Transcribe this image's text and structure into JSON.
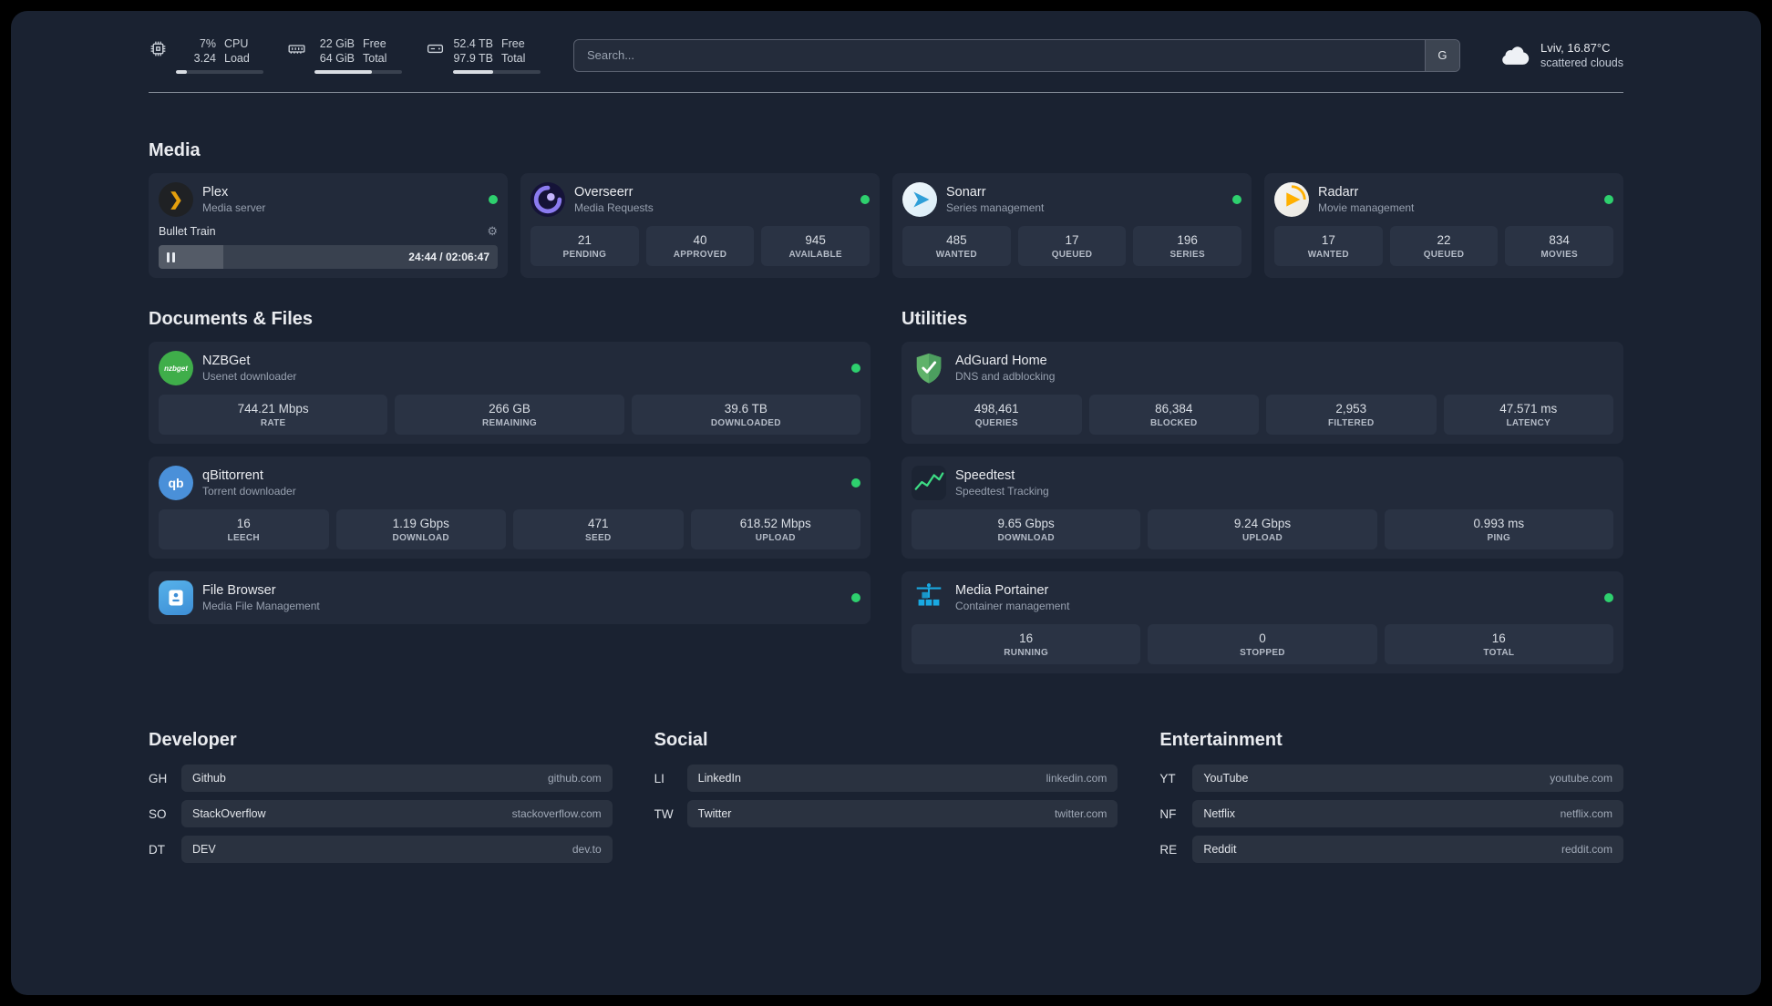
{
  "topbar": {
    "metrics": [
      {
        "val1": "7%",
        "val2": "3.24",
        "lab1": "CPU",
        "lab2": "Load"
      },
      {
        "val1": "22 GiB",
        "val2": "64 GiB",
        "lab1": "Free",
        "lab2": "Total"
      },
      {
        "val1": "52.4 TB",
        "val2": "97.9 TB",
        "lab1": "Free",
        "lab2": "Total"
      }
    ],
    "search": {
      "placeholder": "Search...",
      "button_label": "G"
    },
    "weather": {
      "location": "Lviv, 16.87°C",
      "condition": "scattered clouds"
    }
  },
  "sections": {
    "media": "Media",
    "documents": "Documents & Files",
    "utilities": "Utilities",
    "developer": "Developer",
    "social": "Social",
    "entertainment": "Entertainment"
  },
  "services": {
    "plex": {
      "name": "Plex",
      "desc": "Media server",
      "icon_glyph": "❯",
      "gear_glyph": "⚙",
      "now_playing": "Bullet Train",
      "time": "24:44 / 02:06:47"
    },
    "overseerr": {
      "name": "Overseerr",
      "desc": "Media Requests",
      "stats": [
        {
          "v": "21",
          "l": "PENDING"
        },
        {
          "v": "40",
          "l": "APPROVED"
        },
        {
          "v": "945",
          "l": "AVAILABLE"
        }
      ]
    },
    "sonarr": {
      "name": "Sonarr",
      "desc": "Series management",
      "stats": [
        {
          "v": "485",
          "l": "WANTED"
        },
        {
          "v": "17",
          "l": "QUEUED"
        },
        {
          "v": "196",
          "l": "SERIES"
        }
      ]
    },
    "radarr": {
      "name": "Radarr",
      "desc": "Movie management",
      "stats": [
        {
          "v": "17",
          "l": "WANTED"
        },
        {
          "v": "22",
          "l": "QUEUED"
        },
        {
          "v": "834",
          "l": "MOVIES"
        }
      ]
    },
    "nzbget": {
      "name": "NZBGet",
      "desc": "Usenet downloader",
      "icon_text": "nzbget",
      "stats": [
        {
          "v": "744.21 Mbps",
          "l": "RATE"
        },
        {
          "v": "266 GB",
          "l": "REMAINING"
        },
        {
          "v": "39.6 TB",
          "l": "DOWNLOADED"
        }
      ]
    },
    "qbittorrent": {
      "name": "qBittorrent",
      "desc": "Torrent downloader",
      "icon_text": "qb",
      "stats": [
        {
          "v": "16",
          "l": "LEECH"
        },
        {
          "v": "1.19 Gbps",
          "l": "DOWNLOAD"
        },
        {
          "v": "471",
          "l": "SEED"
        },
        {
          "v": "618.52 Mbps",
          "l": "UPLOAD"
        }
      ]
    },
    "filebrowser": {
      "name": "File Browser",
      "desc": "Media File Management"
    },
    "adguard": {
      "name": "AdGuard Home",
      "desc": "DNS and adblocking",
      "stats": [
        {
          "v": "498,461",
          "l": "QUERIES"
        },
        {
          "v": "86,384",
          "l": "BLOCKED"
        },
        {
          "v": "2,953",
          "l": "FILTERED"
        },
        {
          "v": "47.571 ms",
          "l": "LATENCY"
        }
      ]
    },
    "speedtest": {
      "name": "Speedtest",
      "desc": "Speedtest Tracking",
      "stats": [
        {
          "v": "9.65 Gbps",
          "l": "DOWNLOAD"
        },
        {
          "v": "9.24 Gbps",
          "l": "UPLOAD"
        },
        {
          "v": "0.993 ms",
          "l": "PING"
        }
      ]
    },
    "portainer": {
      "name": "Media Portainer",
      "desc": "Container management",
      "stats": [
        {
          "v": "16",
          "l": "RUNNING"
        },
        {
          "v": "0",
          "l": "STOPPED"
        },
        {
          "v": "16",
          "l": "TOTAL"
        }
      ]
    }
  },
  "bookmarks": {
    "developer": [
      {
        "abbr": "GH",
        "name": "Github",
        "domain": "github.com"
      },
      {
        "abbr": "SO",
        "name": "StackOverflow",
        "domain": "stackoverflow.com"
      },
      {
        "abbr": "DT",
        "name": "DEV",
        "domain": "dev.to"
      }
    ],
    "social": [
      {
        "abbr": "LI",
        "name": "LinkedIn",
        "domain": "linkedin.com"
      },
      {
        "abbr": "TW",
        "name": "Twitter",
        "domain": "twitter.com"
      }
    ],
    "entertainment": [
      {
        "abbr": "YT",
        "name": "YouTube",
        "domain": "youtube.com"
      },
      {
        "abbr": "NF",
        "name": "Netflix",
        "domain": "netflix.com"
      },
      {
        "abbr": "RE",
        "name": "Reddit",
        "domain": "reddit.com"
      }
    ]
  },
  "colors": {
    "status_online": "#2ed06e",
    "accent_green": "#3ddc84"
  }
}
